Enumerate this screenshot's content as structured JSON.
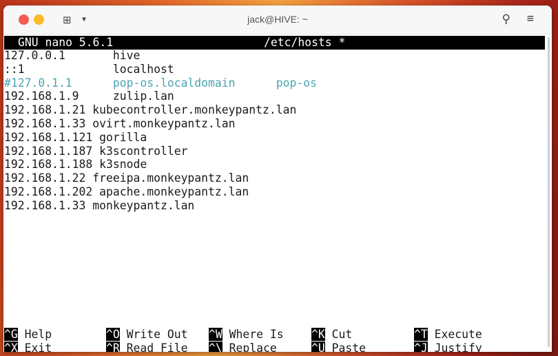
{
  "window": {
    "title": "jack@HIVE: ~"
  },
  "nano": {
    "version": "GNU nano 5.6.1",
    "filename": "/etc/hosts *"
  },
  "lines": [
    {
      "text": "127.0.0.1       hive",
      "comment": false
    },
    {
      "text": "::1             localhost",
      "comment": false
    },
    {
      "text": "#127.0.1.1      pop-os.localdomain      pop-os",
      "comment": true
    },
    {
      "text": "192.168.1.9     zulip.lan",
      "comment": false
    },
    {
      "text": "192.168.1.21 kubecontroller.monkeypantz.lan",
      "comment": false
    },
    {
      "text": "192.168.1.33 ovirt.monkeypantz.lan",
      "comment": false
    },
    {
      "text": "192.168.1.121 gorilla",
      "comment": false
    },
    {
      "text": "192.168.1.187 k3scontroller",
      "comment": false
    },
    {
      "text": "192.168.1.188 k3snode",
      "comment": false
    },
    {
      "text": "192.168.1.22 freeipa.monkeypantz.lan",
      "comment": false
    },
    {
      "text": "192.168.1.202 apache.monkeypantz.lan",
      "comment": false
    },
    {
      "text": "192.168.1.33 monkeypantz.lan",
      "comment": false
    }
  ],
  "shortcuts": [
    [
      {
        "key": "^G",
        "label": "Help"
      },
      {
        "key": "^X",
        "label": "Exit"
      }
    ],
    [
      {
        "key": "^O",
        "label": "Write Out"
      },
      {
        "key": "^R",
        "label": "Read File"
      }
    ],
    [
      {
        "key": "^W",
        "label": "Where Is"
      },
      {
        "key": "^\\",
        "label": "Replace"
      }
    ],
    [
      {
        "key": "^K",
        "label": "Cut"
      },
      {
        "key": "^U",
        "label": "Paste"
      }
    ],
    [
      {
        "key": "^T",
        "label": "Execute"
      },
      {
        "key": "^J",
        "label": "Justify"
      }
    ]
  ]
}
